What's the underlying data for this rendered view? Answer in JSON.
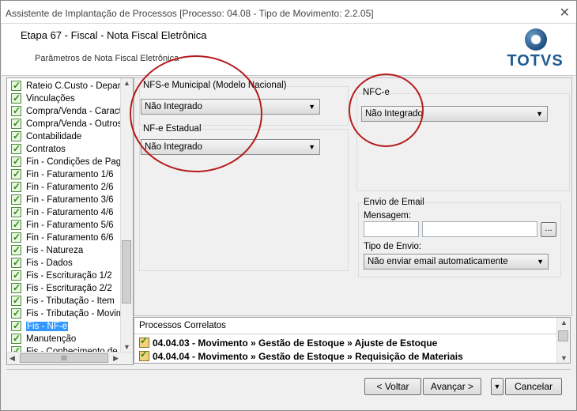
{
  "window": {
    "title": "Assistente de Implantação de Processos [Processo: 04.08 - Tipo de Movimento: 2.2.05]",
    "close_symbol": "✕"
  },
  "header": {
    "step": "Etapa 67 - Fiscal - Nota Fiscal Eletrônica",
    "subtitle": "Parâmetros de Nota Fiscal Eletrônica",
    "logo_text": "TOTVS"
  },
  "sidebar": {
    "items": [
      {
        "label": "Rateio C.Custo - Depart"
      },
      {
        "label": "Vinculações"
      },
      {
        "label": "Compra/Venda - Caracte"
      },
      {
        "label": "Compra/Venda - Outros"
      },
      {
        "label": "Contabilidade"
      },
      {
        "label": "Contratos"
      },
      {
        "label": "Fin - Condições de Paga"
      },
      {
        "label": "Fin - Faturamento 1/6"
      },
      {
        "label": "Fin - Faturamento 2/6"
      },
      {
        "label": "Fin - Faturamento 3/6"
      },
      {
        "label": "Fin - Faturamento 4/6"
      },
      {
        "label": "Fin - Faturamento 5/6"
      },
      {
        "label": "Fin - Faturamento 6/6"
      },
      {
        "label": "Fis - Natureza"
      },
      {
        "label": "Fis - Dados"
      },
      {
        "label": "Fis - Escrituração 1/2"
      },
      {
        "label": "Fis - Escrituração 2/2"
      },
      {
        "label": "Fis - Tributação - Item"
      },
      {
        "label": "Fis - Tributação - Movim"
      },
      {
        "label": "Fis - NF-e"
      },
      {
        "label": "Manutenção"
      },
      {
        "label": "Fis - Conhecimento de T"
      }
    ],
    "selected_index": 19,
    "hscroll_grip": "III"
  },
  "nfse": {
    "label": "NFS-e Municipal (Modelo Nacional)",
    "value": "Não Integrado"
  },
  "nfe": {
    "label": "NF-e Estadual",
    "value": "Não Integrado"
  },
  "nfce": {
    "label": "NFC-e",
    "value": "Não Integrado"
  },
  "email": {
    "group_label": "Envio de Email",
    "message_label": "Mensagem:",
    "message_value": "",
    "message_desc_value": "",
    "browse_label": "...",
    "send_type_label": "Tipo de Envio:",
    "send_type_value": "Não enviar email automaticamente"
  },
  "related": {
    "title": "Processos Correlatos",
    "items": [
      {
        "text": "04.04.03 - Movimento » Gestão de Estoque » Ajuste de Estoque"
      },
      {
        "text": "04.04.04 - Movimento » Gestão de Estoque » Requisição de Materiais"
      }
    ]
  },
  "buttons": {
    "back": "< Voltar",
    "next": "Avançar >",
    "menu_caret": "▼",
    "cancel": "Cancelar"
  },
  "colors": {
    "annotation_circle": "#b51d1d",
    "selection": "#3399ff",
    "brand": "#1f5c94"
  }
}
